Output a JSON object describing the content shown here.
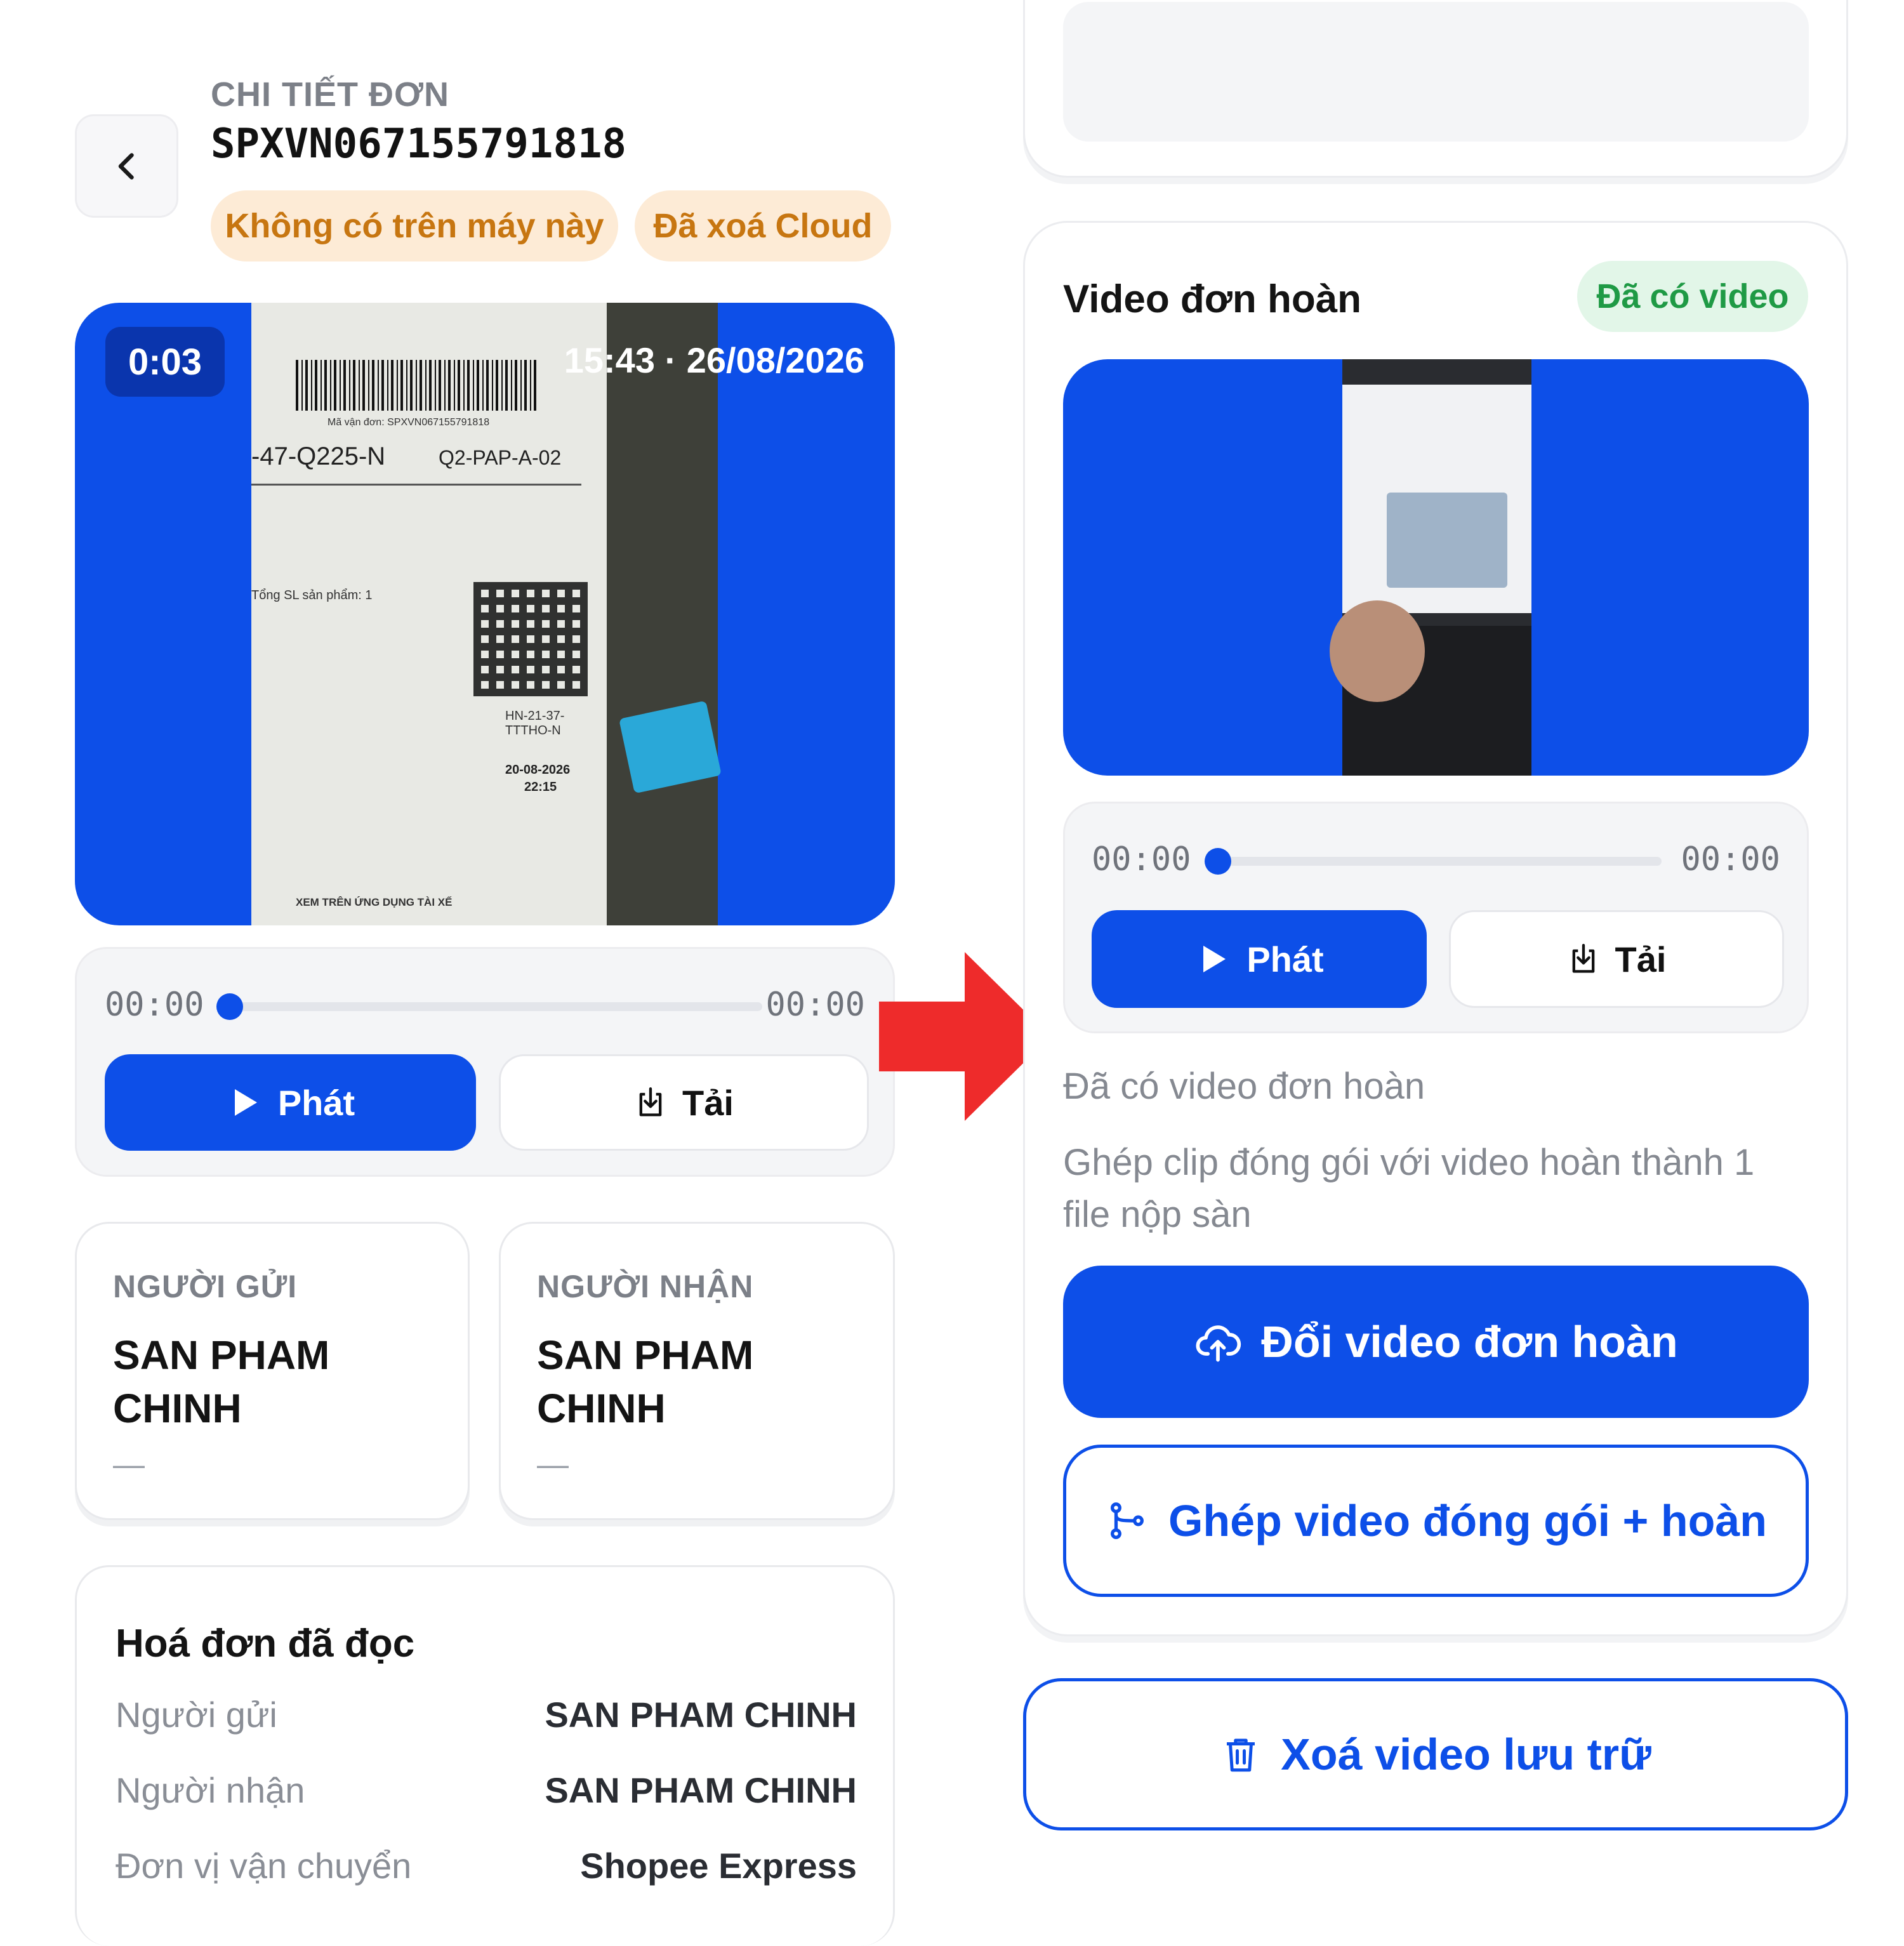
{
  "header": {
    "eyebrow": "CHI TIẾT ĐƠN",
    "order_id": "SPXVN067155791818",
    "badges": [
      "Không có trên máy này",
      "Đã xoá Cloud"
    ]
  },
  "packing_video": {
    "duration_overlay": "0:03",
    "timestamp": "15:43 · 26/08/2026",
    "label": {
      "tracking": "Mã vận đơn: SPXVN067155791818",
      "sort_code_left": "-47-Q225-N",
      "sort_code_right": "Q2-PAP-A-02",
      "route": "HN-21-37-TTTHO-N",
      "date": "20-08-2026",
      "time": "22:15",
      "total_products": "Tổng SL sản phẩm: 1",
      "footer": "XEM TRÊN ỨNG DỤNG TÀI XẾ"
    },
    "player": {
      "current": "00:00",
      "total": "00:00",
      "progress": 0,
      "play_label": "Phát",
      "download_label": "Tải"
    }
  },
  "sender_card": {
    "label": "NGƯỜI GỬI",
    "name_line1": "SAN PHAM",
    "name_line2": "CHINH",
    "extra": "—"
  },
  "receiver_card": {
    "label": "NGƯỜI NHẬN",
    "name_line1": "SAN PHAM",
    "name_line2": "CHINH",
    "extra": "—"
  },
  "invoice": {
    "title": "Hoá đơn đã đọc",
    "rows": [
      {
        "label": "Người gửi",
        "value": "SAN PHAM CHINH"
      },
      {
        "label": "Người nhận",
        "value": "SAN PHAM CHINH"
      },
      {
        "label": "Đơn vị vận chuyển",
        "value": "Shopee Express"
      }
    ]
  },
  "return_video": {
    "title": "Video đơn hoàn",
    "status_badge": "Đã có video",
    "player": {
      "current": "00:00",
      "total": "00:00",
      "progress": 0,
      "play_label": "Phát",
      "download_label": "Tải"
    },
    "status_text": "Đã có video đơn hoàn",
    "hint_line1": "Ghép clip đóng gói với video hoàn thành 1",
    "hint_line2": "file nộp sàn",
    "change_button": "Đổi video đơn hoàn",
    "merge_button": "Ghép video đóng gói + hoàn"
  },
  "delete_button": "Xoá video lưu trữ",
  "colors": {
    "primary": "#0d4fe8",
    "arrow": "#ee2b2b",
    "warn_bg": "#fdebd6",
    "warn_text": "#c77611",
    "ok_bg": "#e2f6e8",
    "ok_text": "#1f9a45"
  },
  "icons": [
    "chevron-left-icon",
    "play-icon",
    "download-icon",
    "cloud-upload-icon",
    "merge-icon",
    "trash-icon",
    "arrow-right-icon"
  ]
}
